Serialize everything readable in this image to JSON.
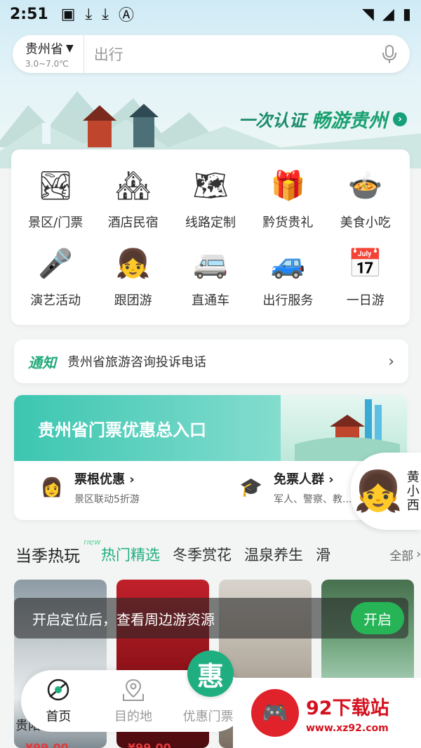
{
  "status": {
    "time": "2:51"
  },
  "location": {
    "city": "贵州省",
    "temp": "3.0~7.0℃"
  },
  "search": {
    "placeholder": "出行"
  },
  "banner": {
    "slogan_a": "一次认证",
    "slogan_b": "畅游贵州"
  },
  "grid": [
    {
      "label": "景区/门票",
      "icon": "waterfall-icon",
      "glyph": "🏞"
    },
    {
      "label": "酒店民宿",
      "icon": "hotel-icon",
      "glyph": "🏘"
    },
    {
      "label": "线路定制",
      "icon": "map-icon",
      "glyph": "🗺"
    },
    {
      "label": "黔货贵礼",
      "icon": "gift-icon",
      "glyph": "🎁"
    },
    {
      "label": "美食小吃",
      "icon": "hotpot-icon",
      "glyph": "🍲"
    },
    {
      "label": "演艺活动",
      "icon": "microphone-icon",
      "glyph": "🎤"
    },
    {
      "label": "跟团游",
      "icon": "tour-guide-icon",
      "glyph": "👧"
    },
    {
      "label": "直通车",
      "icon": "bus-icon",
      "glyph": "🚐"
    },
    {
      "label": "出行服务",
      "icon": "car-service-icon",
      "glyph": "🚙"
    },
    {
      "label": "一日游",
      "icon": "calendar-icon",
      "glyph": "📅"
    }
  ],
  "notice": {
    "tag": "通知",
    "text": "贵州省旅游咨询投诉电话"
  },
  "promo": {
    "title": "贵州省门票优惠总入口",
    "items": [
      {
        "title": "票根优惠",
        "desc": "景区联动5折游"
      },
      {
        "title": "免票人群",
        "desc": "军人、警察、教..."
      }
    ]
  },
  "mascot": {
    "text": "黄小西"
  },
  "section": {
    "title": "当季热玩",
    "badge": "new",
    "tabs": [
      "热门精选",
      "冬季赏花",
      "温泉养生",
      "滑"
    ],
    "all": "全部"
  },
  "tiles": [
    {
      "title": "贵阳",
      "price": "¥99.00"
    },
    {
      "title": "",
      "price": "¥99.00"
    },
    {
      "title": "",
      "price": ""
    },
    {
      "title": "",
      "price": ""
    }
  ],
  "location_prompt": {
    "text": "开启定位后，查看周边游资源",
    "button": "开启"
  },
  "nav": {
    "home": "首页",
    "destination": "目的地",
    "deals": "优惠门票",
    "fab": "惠"
  },
  "watermark": {
    "name": "92下载站",
    "url": "www.xz92.com"
  }
}
